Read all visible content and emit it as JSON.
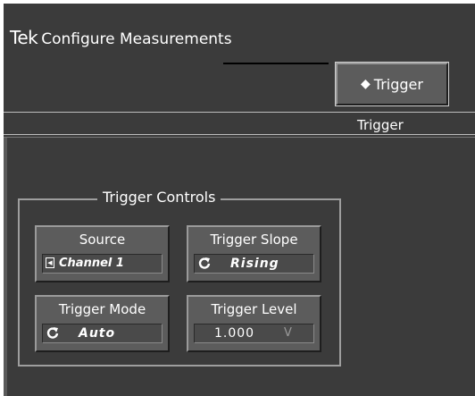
{
  "header": {
    "brand": "Tek",
    "title": "Configure Measurements"
  },
  "tab_button": {
    "label": "Trigger",
    "icon": "diamond-icon"
  },
  "tab_label": "Trigger",
  "group": {
    "title": "Trigger Controls",
    "controls": [
      {
        "label": "Source",
        "value": "Channel 1",
        "icon": "left-arrow-icon"
      },
      {
        "label": "Trigger Slope",
        "value": "Rising",
        "icon": "cycle-icon"
      },
      {
        "label": "Trigger Mode",
        "value": "Auto",
        "icon": "cycle-icon"
      },
      {
        "label": "Trigger Level",
        "value": "1.000",
        "unit": "V"
      }
    ]
  },
  "colors": {
    "panel_bg": "#3b3b3b",
    "button_face": "#5c5c5c",
    "text": "#ffffff",
    "unit_text": "#9a9a9a"
  }
}
